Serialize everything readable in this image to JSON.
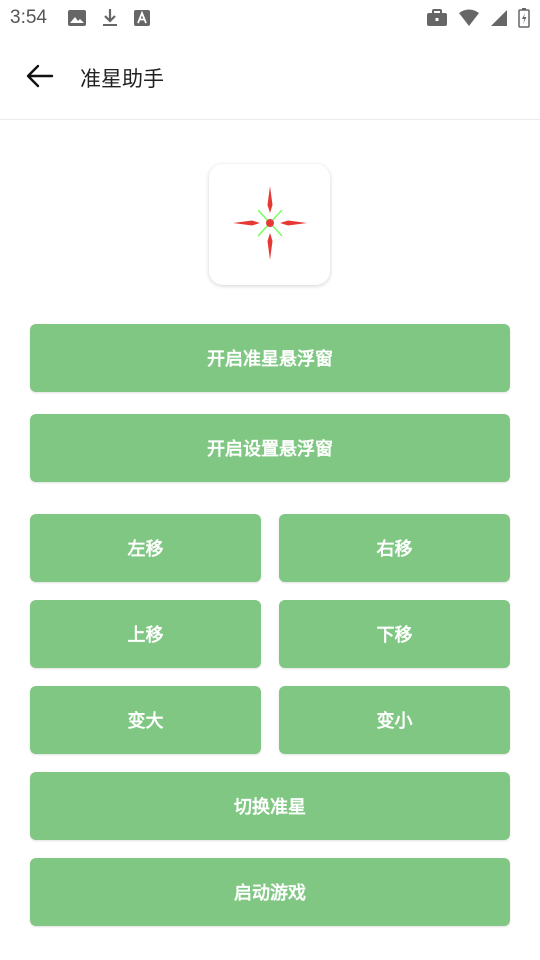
{
  "status_bar": {
    "time": "3:54",
    "icons_left": [
      "image-icon",
      "download-icon",
      "a-icon"
    ],
    "icons_right": [
      "briefcase-icon",
      "wifi-icon",
      "signal-icon",
      "battery-icon"
    ]
  },
  "app_bar": {
    "back_icon": "arrow-left-icon",
    "title": "准星助手"
  },
  "logo": {
    "icon": "crosshair-icon"
  },
  "buttons": {
    "open_crosshair_window": "开启准星悬浮窗",
    "open_settings_window": "开启设置悬浮窗",
    "move_left": "左移",
    "move_right": "右移",
    "move_up": "上移",
    "move_down": "下移",
    "enlarge": "变大",
    "shrink": "变小",
    "switch_crosshair": "切换准星",
    "launch_game": "启动游戏"
  },
  "colors": {
    "button_bg": "#81c784",
    "button_text": "#ffffff",
    "crosshair_red": "#e53935",
    "crosshair_green": "#76ff5c"
  }
}
